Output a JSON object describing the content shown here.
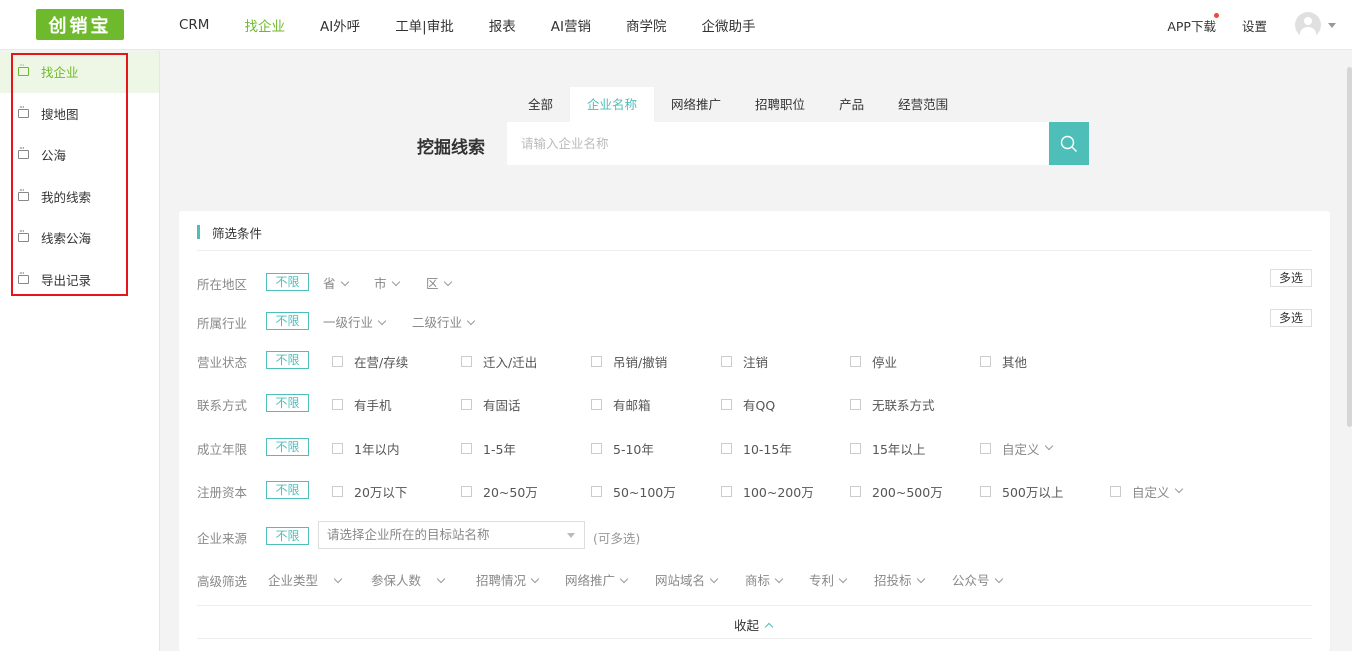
{
  "brand": {
    "logo_text": "创销宝",
    "accent": "#6fba2c",
    "teal": "#4ebfb8"
  },
  "nav": {
    "items": [
      {
        "label": "CRM",
        "active": false
      },
      {
        "label": "找企业",
        "active": true
      },
      {
        "label": "AI外呼",
        "active": false
      },
      {
        "label": "工单|审批",
        "active": false
      },
      {
        "label": "报表",
        "active": false
      },
      {
        "label": "AI营销",
        "active": false
      },
      {
        "label": "商学院",
        "active": false
      },
      {
        "label": "企微助手",
        "active": false
      }
    ],
    "app_download": "APP下载",
    "settings": "设置"
  },
  "sidebar": {
    "items": [
      {
        "label": "找企业",
        "icon": "message-icon",
        "active": true
      },
      {
        "label": "搜地图",
        "icon": "message-icon"
      },
      {
        "label": "公海",
        "icon": "message-icon"
      },
      {
        "label": "我的线索",
        "icon": "message-icon"
      },
      {
        "label": "线索公海",
        "icon": "message-icon"
      },
      {
        "label": "导出记录",
        "icon": "message-icon"
      }
    ]
  },
  "search": {
    "tabs": [
      "全部",
      "企业名称",
      "网络推广",
      "招聘职位",
      "产品",
      "经营范围"
    ],
    "active_tab": "企业名称",
    "title": "挖掘线索",
    "placeholder": "请输入企业名称"
  },
  "filters": {
    "title": "筛选条件",
    "unlimited": "不限",
    "multi": "多选",
    "region": {
      "label": "所在地区",
      "dropdowns": [
        "省",
        "市",
        "区"
      ]
    },
    "industry": {
      "label": "所属行业",
      "dropdowns": [
        "一级行业",
        "二级行业"
      ]
    },
    "status": {
      "label": "营业状态",
      "options": [
        "在营/存续",
        "迁入/迁出",
        "吊销/撤销",
        "注销",
        "停业",
        "其他"
      ]
    },
    "contact": {
      "label": "联系方式",
      "options": [
        "有手机",
        "有固话",
        "有邮箱",
        "有QQ",
        "无联系方式"
      ]
    },
    "years": {
      "label": "成立年限",
      "options": [
        "1年以内",
        "1-5年",
        "5-10年",
        "10-15年",
        "15年以上"
      ],
      "custom": "自定义"
    },
    "capital": {
      "label": "注册资本",
      "options": [
        "20万以下",
        "20~50万",
        "50~100万",
        "100~200万",
        "200~500万",
        "500万以上"
      ],
      "custom": "自定义"
    },
    "source": {
      "label": "企业来源",
      "placeholder": "请选择企业所在的目标站名称",
      "hint": "(可多选)"
    },
    "advanced": {
      "label": "高级筛选",
      "dropdowns": [
        "企业类型",
        "参保人数",
        "招聘情况",
        "网络推广",
        "网站域名",
        "商标",
        "专利",
        "招投标",
        "公众号"
      ]
    },
    "collapse": "收起"
  }
}
